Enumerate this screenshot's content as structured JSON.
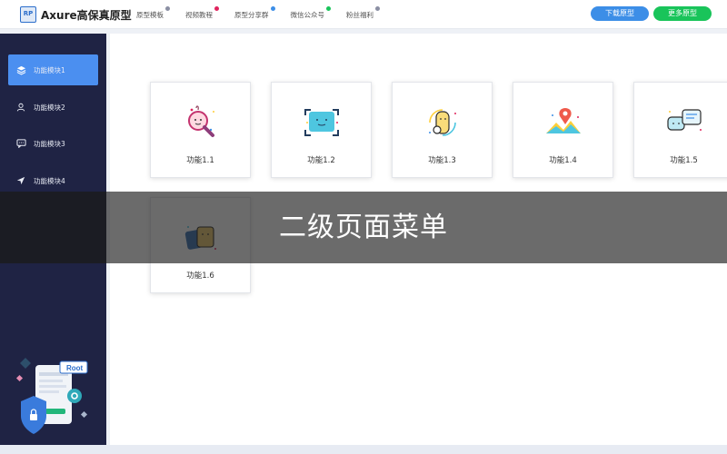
{
  "header": {
    "logo_text": "RP",
    "brand": "Axure高保真原型",
    "nav": [
      {
        "label": "原型模板",
        "dot_color": "#8b8fa3"
      },
      {
        "label": "视频教程",
        "dot_color": "#e0245e"
      },
      {
        "label": "原型分享群",
        "dot_color": "#3c8ee7"
      },
      {
        "label": "微信公众号",
        "dot_color": "#19c45a"
      },
      {
        "label": "粉丝福利",
        "dot_color": "#8b8fa3"
      }
    ],
    "download_label": "下载原型",
    "more_label": "更多原型"
  },
  "sidebar": {
    "items": [
      {
        "label": "功能模块1",
        "icon": "layers-icon",
        "active": true
      },
      {
        "label": "功能模块2",
        "icon": "user-icon",
        "active": false
      },
      {
        "label": "功能模块3",
        "icon": "chat-icon",
        "active": false
      },
      {
        "label": "功能模块4",
        "icon": "navigation-icon",
        "active": false
      }
    ],
    "illustration_text": "Root"
  },
  "cards": [
    {
      "label": "功能1.1",
      "icon": "search-icon"
    },
    {
      "label": "功能1.2",
      "icon": "scan-face-icon"
    },
    {
      "label": "功能1.3",
      "icon": "dial-icon"
    },
    {
      "label": "功能1.4",
      "icon": "map-pin-icon"
    },
    {
      "label": "功能1.5",
      "icon": "chat-bubbles-icon"
    },
    {
      "label": "功能1.6",
      "icon": "cards-icon"
    }
  ],
  "overlay": {
    "title": "二级页面菜单"
  },
  "colors": {
    "sidebar_bg": "#1f2344",
    "active_item": "#4b8ff0",
    "download_button": "#3c8ee7",
    "more_button": "#19c45a"
  }
}
